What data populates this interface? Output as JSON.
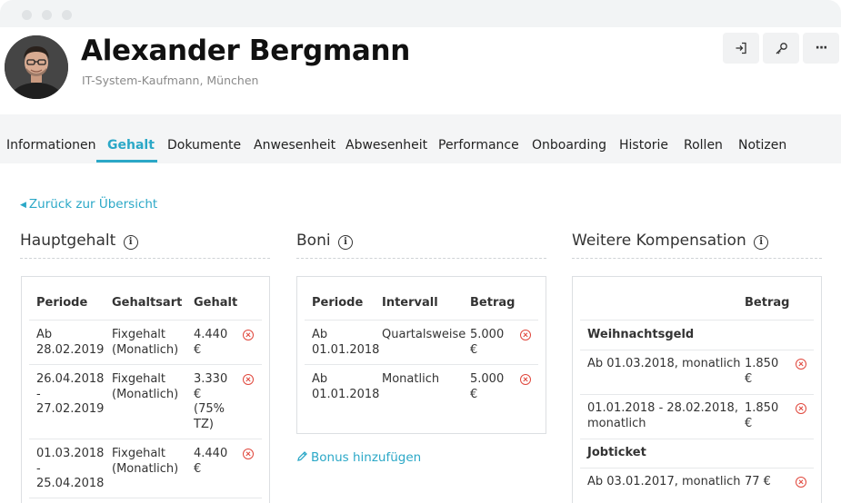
{
  "profile": {
    "name": "Alexander Bergmann",
    "subtitle": "IT-System-Kaufmann, München"
  },
  "header_actions": [
    {
      "icon": "sign-in-icon"
    },
    {
      "icon": "key-icon"
    },
    {
      "icon": "more-icon",
      "label": "···"
    }
  ],
  "tabs": [
    "Informationen",
    "Gehalt",
    "Dokumente",
    "Anwesenheit",
    "Abwesenheit",
    "Performance",
    "Onboarding",
    "Historie",
    "Rollen",
    "Notizen"
  ],
  "active_tab": "Gehalt",
  "back_link": "Zurück zur Übersicht",
  "hauptgehalt": {
    "title": "Hauptgehalt",
    "columns": [
      "Periode",
      "Gehaltsart",
      "Gehalt"
    ],
    "rows": [
      {
        "periode": "Ab\n28.02.2019",
        "art": "Fixgehalt\n(Monatlich)",
        "gehalt": "4.440\n€"
      },
      {
        "periode": "26.04.2018\n-\n27.02.2019",
        "art": "Fixgehalt\n(Monatlich)",
        "gehalt": "3.330\n€\n(75%\nTZ)"
      },
      {
        "periode": "01.03.2018\n-\n25.04.2018",
        "art": "Fixgehalt\n(Monatlich)",
        "gehalt": "4.440\n€"
      }
    ]
  },
  "boni": {
    "title": "Boni",
    "columns": [
      "Periode",
      "Intervall",
      "Betrag"
    ],
    "rows": [
      {
        "periode": "Ab\n01.01.2018",
        "intervall": "Quartalsweise",
        "betrag": "5.000\n€"
      },
      {
        "periode": "Ab\n01.01.2018",
        "intervall": "Monatlich",
        "betrag": "5.000\n€"
      }
    ],
    "add_label": "Bonus hinzufügen"
  },
  "weitere": {
    "title": "Weitere Kompensation",
    "column": "Betrag",
    "groups": [
      {
        "name": "Weihnachtsgeld",
        "rows": [
          {
            "periode": "Ab 01.03.2018, monatlich",
            "betrag": "1.850\n€"
          },
          {
            "periode": "01.01.2018 - 28.02.2018,\nmonatlich",
            "betrag": "1.850\n€"
          }
        ]
      },
      {
        "name": "Jobticket",
        "rows": [
          {
            "periode": "Ab 03.01.2017, monatlich",
            "betrag": "77 €"
          }
        ]
      }
    ]
  },
  "colors": {
    "accent": "#2ba8c7",
    "delete": "#e0473c",
    "tabbar": "#f4f5f6"
  }
}
